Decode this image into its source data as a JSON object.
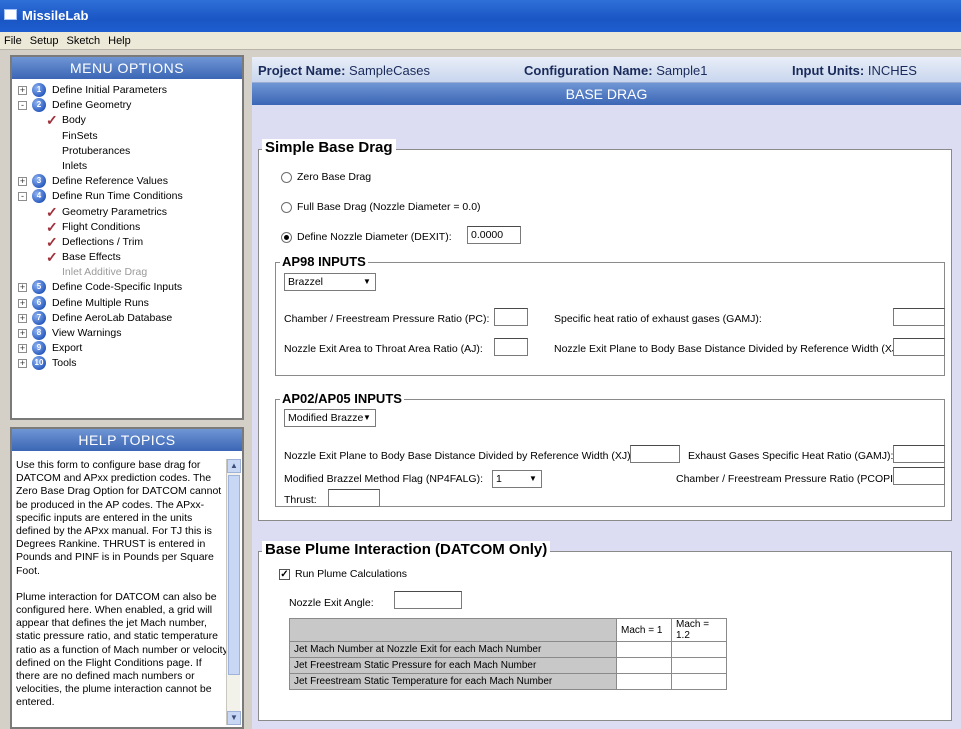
{
  "window": {
    "title": "MissileLab"
  },
  "menubar": {
    "items": [
      "File",
      "Setup",
      "Sketch",
      "Help"
    ]
  },
  "menu_options": {
    "title": "MENU OPTIONS",
    "tree": [
      {
        "label": "Define Initial Parameters",
        "num": "1",
        "level": 0,
        "expander": "+"
      },
      {
        "label": "Define Geometry",
        "num": "2",
        "level": 0,
        "expander": "-"
      },
      {
        "label": "Body",
        "level": 1,
        "checked": true
      },
      {
        "label": "FinSets",
        "level": 1,
        "checked": false
      },
      {
        "label": "Protuberances",
        "level": 1,
        "checked": false
      },
      {
        "label": "Inlets",
        "level": 1,
        "checked": false
      },
      {
        "label": "Define Reference Values",
        "num": "3",
        "level": 0,
        "expander": "+"
      },
      {
        "label": "Define Run Time Conditions",
        "num": "4",
        "level": 0,
        "expander": "-"
      },
      {
        "label": "Geometry Parametrics",
        "level": 1,
        "checked": true
      },
      {
        "label": "Flight Conditions",
        "level": 1,
        "checked": true
      },
      {
        "label": "Deflections / Trim",
        "level": 1,
        "checked": true
      },
      {
        "label": "Base Effects",
        "level": 1,
        "checked": true
      },
      {
        "label": "Inlet Additive Drag",
        "level": 1,
        "checked": false,
        "disabled": true
      },
      {
        "label": "Define Code-Specific Inputs",
        "num": "5",
        "level": 0,
        "expander": "+"
      },
      {
        "label": "Define Multiple Runs",
        "num": "6",
        "level": 0,
        "expander": "+"
      },
      {
        "label": "Define AeroLab Database",
        "num": "7",
        "level": 0,
        "expander": "+"
      },
      {
        "label": "View Warnings",
        "num": "8",
        "level": 0,
        "expander": "+"
      },
      {
        "label": "Export",
        "num": "9",
        "level": 0,
        "expander": "+"
      },
      {
        "label": "Tools",
        "num": "10",
        "level": 0,
        "expander": "+"
      }
    ]
  },
  "help_topics": {
    "title": "HELP TOPICS",
    "para1": "Use this form to configure base drag for DATCOM and APxx prediction codes. The Zero Base Drag Option for DATCOM cannot be produced in the AP codes. The APxx-specific inputs are entered in the units defined by the APxx manual. For TJ this is Degrees Rankine. THRUST is entered in Pounds and PINF is in Pounds per Square Foot.",
    "para2": "Plume interaction for DATCOM can also be configured here. When enabled, a grid will appear that defines the jet Mach number, static pressure ratio, and static temperature ratio as a function of Mach number or velocity defined on the Flight Conditions page. If there are no defined mach numbers or velocities, the plume interaction cannot be entered."
  },
  "header": {
    "project_label": "Project Name:",
    "project_value": "SampleCases",
    "config_label": "Configuration Name:",
    "config_value": "Sample1",
    "units_label": "Input Units:",
    "units_value": "INCHES"
  },
  "section_title": "BASE DRAG",
  "simple_base_drag": {
    "title": "Simple Base Drag",
    "opt_zero": "Zero Base Drag",
    "opt_full": "Full Base Drag (Nozzle Diameter = 0.0)",
    "opt_define": "Define Nozzle Diameter (DEXIT):",
    "dexit_value": "0.0000",
    "selected": "define"
  },
  "ap98": {
    "title": "AP98 INPUTS",
    "method": "Brazzel",
    "pc_label": "Chamber / Freestream Pressure Ratio (PC):",
    "gamj_label": "Specific heat ratio of exhaust gases (GAMJ):",
    "aj_label": "Nozzle Exit Area to Throat Area Ratio (AJ):",
    "xj_label": "Nozzle Exit Plane to Body Base Distance Divided by Reference Width (XJ):"
  },
  "ap02": {
    "title": "AP02/AP05 INPUTS",
    "method": "Modified Brazze",
    "xj_label": "Nozzle Exit Plane to Body Base Distance Divided by Reference Width (XJ):",
    "gamj_label": "Exhaust Gases Specific Heat Ratio (GAMJ):",
    "flag_label": "Modified Brazzel Method Flag (NP4FALG):",
    "flag_value": "1",
    "pcopi_label": "Chamber / Freestream Pressure Ratio (PCOPI):",
    "thrust_label": "Thrust:"
  },
  "plume": {
    "title": "Base Plume Interaction (DATCOM Only)",
    "run_label": "Run Plume Calculations",
    "run_checked": true,
    "angle_label": "Nozzle Exit Angle:",
    "columns": [
      "Mach = 1",
      "Mach = 1.2"
    ],
    "rows": [
      "Jet Mach Number at Nozzle Exit for each Mach Number",
      "Jet Freestream Static Pressure for each Mach Number",
      "Jet Freestream Static Temperature for each Mach Number"
    ]
  }
}
